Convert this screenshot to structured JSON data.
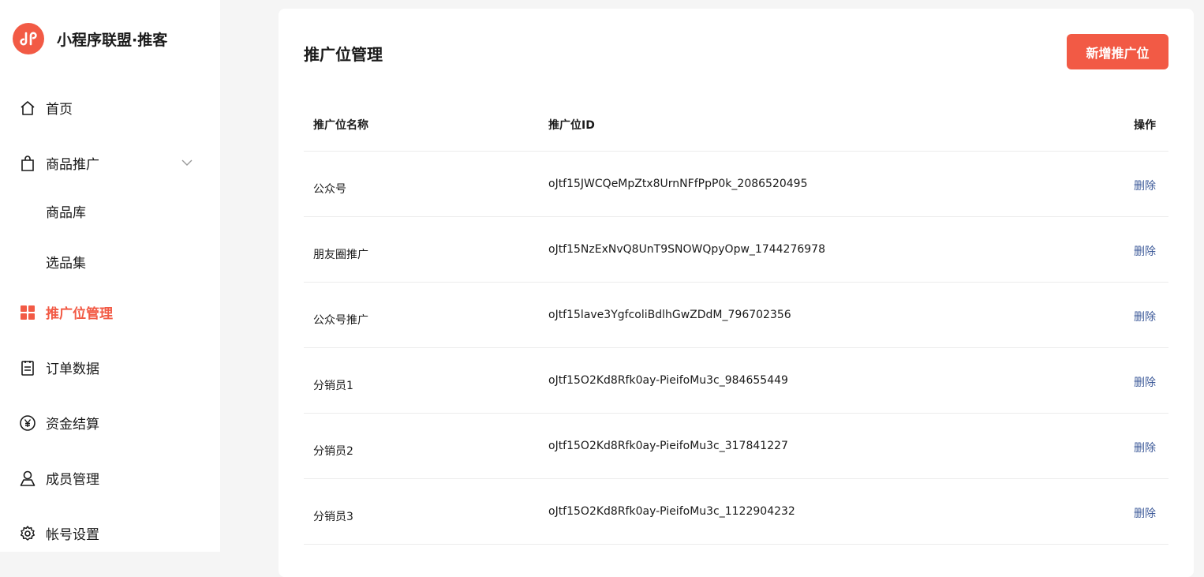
{
  "app": {
    "title": "小程序联盟·推客",
    "accent": "#f25a45"
  },
  "sidebar": {
    "items": [
      {
        "label": "首页",
        "icon": "home-icon"
      },
      {
        "label": "商品推广",
        "icon": "shopping-bag-icon",
        "expanded": true,
        "children": [
          {
            "label": "商品库"
          },
          {
            "label": "选品集"
          }
        ]
      },
      {
        "label": "推广位管理",
        "icon": "grid-icon",
        "active": true
      },
      {
        "label": "订单数据",
        "icon": "clipboard-icon"
      },
      {
        "label": "资金结算",
        "icon": "yuan-icon"
      },
      {
        "label": "成员管理",
        "icon": "user-icon"
      },
      {
        "label": "帐号设置",
        "icon": "gear-icon"
      }
    ]
  },
  "main": {
    "title": "推广位管理",
    "add_button": "新增推广位",
    "table": {
      "headers": [
        "推广位名称",
        "推广位ID",
        "操作"
      ],
      "rows": [
        {
          "name": "公众号",
          "id": "oJtf15JWCQeMpZtx8UrnNFfPpP0k_2086520495",
          "action": "删除"
        },
        {
          "name": "朋友圈推广",
          "id": "oJtf15NzExNvQ8UnT9SNOWQpyOpw_1744276978",
          "action": "删除"
        },
        {
          "name": "公众号推广",
          "id": "oJtf15lave3YgfcoliBdlhGwZDdM_796702356",
          "action": "删除"
        },
        {
          "name": "分销员1",
          "id": "oJtf15O2Kd8Rfk0ay-PieifoMu3c_984655449",
          "action": "删除"
        },
        {
          "name": "分销员2",
          "id": "oJtf15O2Kd8Rfk0ay-PieifoMu3c_317841227",
          "action": "删除"
        },
        {
          "name": "分销员3",
          "id": "oJtf15O2Kd8Rfk0ay-PieifoMu3c_1122904232",
          "action": "删除"
        }
      ]
    }
  }
}
